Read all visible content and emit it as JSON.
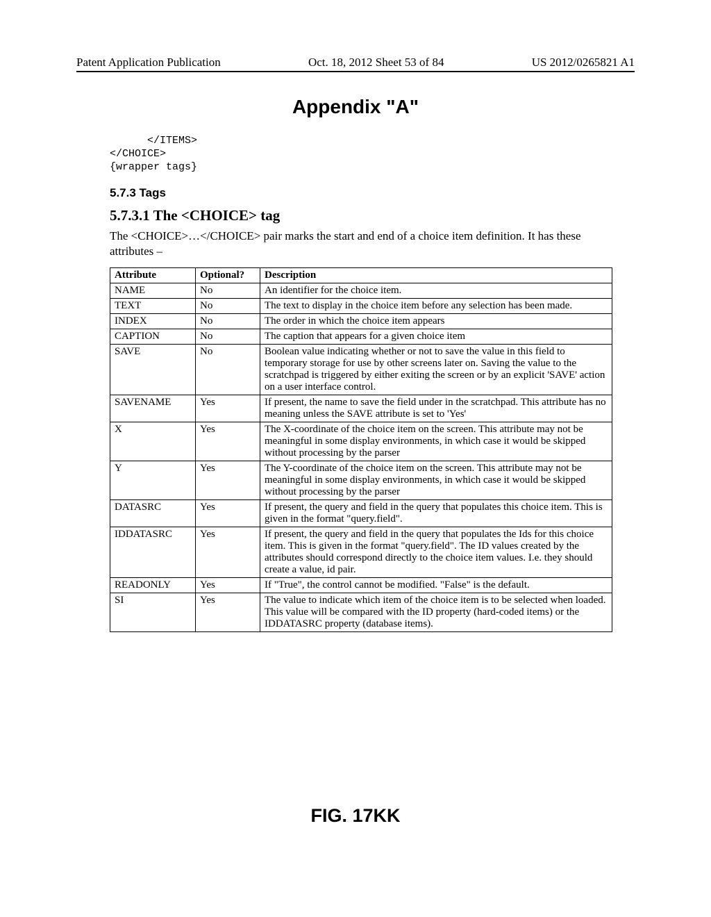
{
  "header": {
    "left": "Patent Application Publication",
    "center": "Oct. 18, 2012  Sheet 53 of 84",
    "right": "US 2012/0265821 A1"
  },
  "appendix_title": "Appendix \"A\"",
  "code_lines": "      </ITEMS>\n</CHOICE>\n{wrapper tags}",
  "section": "5.7.3  Tags",
  "subsection": "5.7.3.1  The <CHOICE> tag",
  "paragraph": "The <CHOICE>…</CHOICE> pair marks the start and end of a choice item definition. It has these attributes –",
  "table": {
    "headers": [
      "Attribute",
      "Optional?",
      "Description"
    ],
    "rows": [
      {
        "attr": "NAME",
        "opt": "No",
        "desc": "An identifier for the choice item."
      },
      {
        "attr": "TEXT",
        "opt": "No",
        "desc": "The text to display in the choice item before any selection has been made."
      },
      {
        "attr": "INDEX",
        "opt": "No",
        "desc": "The order in which the choice item appears"
      },
      {
        "attr": "CAPTION",
        "opt": "No",
        "desc": "The caption that appears for a given choice item"
      },
      {
        "attr": "SAVE",
        "opt": "No",
        "desc": "Boolean value indicating whether or not to save the value in this field to temporary storage for use by other screens later on. Saving the value to the scratchpad is triggered by either exiting the screen or by an explicit 'SAVE' action on a user interface control."
      },
      {
        "attr": "SAVENAME",
        "opt": "Yes",
        "desc": "If present, the name to save the field under in the scratchpad. This attribute has no meaning unless the SAVE attribute is set to 'Yes'"
      },
      {
        "attr": "X",
        "opt": "Yes",
        "desc": "The X-coordinate of the choice item on the screen. This attribute may not be meaningful in some display environments, in which case it would be skipped without processing by the parser"
      },
      {
        "attr": "Y",
        "opt": "Yes",
        "desc": "The Y-coordinate of the choice item on the screen. This attribute may not be meaningful in some display environments, in which case it would be skipped without processing by the parser"
      },
      {
        "attr": "DATASRC",
        "opt": "Yes",
        "desc": "If present, the query and field in the query that populates this choice item. This is given in the format \"query.field\"."
      },
      {
        "attr": "IDDATASRC",
        "opt": "Yes",
        "desc": "If present, the query and field in the query that populates the Ids for this choice item. This is given in the format \"query.field\". The ID values created by the attributes should correspond directly to the choice item values. I.e. they should create a value, id pair."
      },
      {
        "attr": "READONLY",
        "opt": "Yes",
        "desc": "If \"True\", the control cannot be modified. \"False\" is the default."
      },
      {
        "attr": "SI",
        "opt": "Yes",
        "desc": "The value to indicate which item of the choice item is to be selected when loaded.  This value will be compared with the ID property (hard-coded items) or the IDDATASRC property (database items)."
      }
    ]
  },
  "figure_label": "FIG. 17KK"
}
